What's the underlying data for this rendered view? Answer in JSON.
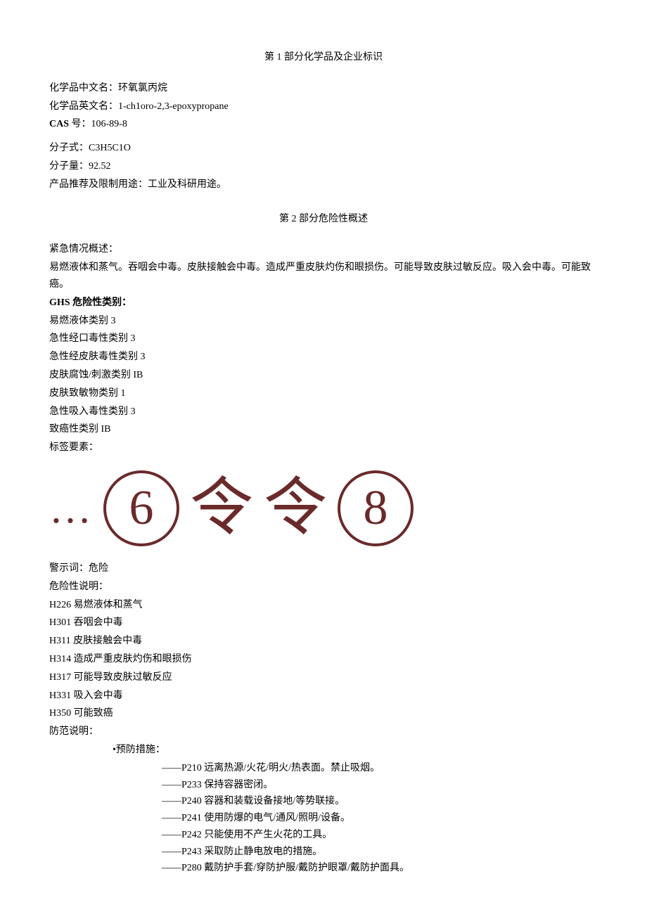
{
  "section1": {
    "title": "第 1 部分化学品及企业标识",
    "lines": [
      "化学品中文名：环氧氯丙烷",
      "化学品英文名：1-ch1oro-2,3-epoxypropane"
    ],
    "cas_label": "CAS",
    "cas_text": " 号：106-89-8",
    "formula": "分子式：C3H5C1O",
    "mw": "分子量：92.52",
    "use": "产品推荐及限制用途：工业及科研用途。"
  },
  "section2": {
    "title": "第 2 部分危险性概述",
    "emerg_head": "紧急情况概述：",
    "emerg_body": "易燃液体和蒸气。吞咽会中毒。皮肤接触会中毒。造成严重皮肤灼伤和眼损伤。可能导致皮肤过敏反应。吸入会中毒。可能致癌。",
    "ghs_head": "GHS 危险性类别：",
    "ghs_cats": [
      "易燃液体类别 3",
      "急性经口毒性类别 3",
      "急性经皮肤毒性类别 3",
      "皮肤腐蚀/刺激类别 IB",
      "皮肤致敏物类别 1",
      "急性吸入毒性类别 3",
      "致癌性类别 IB"
    ],
    "label_elem": "标签要素：",
    "picts": [
      "…",
      "6",
      "令",
      "令",
      "8"
    ],
    "signal": "警示词：危险",
    "hazard_head": "危险性说明：",
    "hstatements": [
      "H226 易燃液体和蒸气",
      "H301 吞咽会中毒",
      "H311 皮肤接触会中毒",
      "H314 造成严重皮肤灼伤和眼损伤",
      "H317 可能导致皮肤过敏反应",
      "H331 吸入会中毒",
      "H350 可能致癌"
    ],
    "prec_head": "防范说明：",
    "prec_sub": "•预防措施：",
    "pstatements": [
      "——P210 远离热源/火花/明火/热表面。禁止吸烟。",
      "——P233 保持容器密闭。",
      "——P240 容器和装载设备接地/等势联接。",
      "——P241 使用防爆的电气/通风/照明/设备。",
      "——P242 只能使用不产生火花的工具。",
      "——P243 采取防止静电放电的措施。",
      "——P280 戴防护手套/穿防护服/戴防护眼罩/戴防护面具。"
    ]
  }
}
